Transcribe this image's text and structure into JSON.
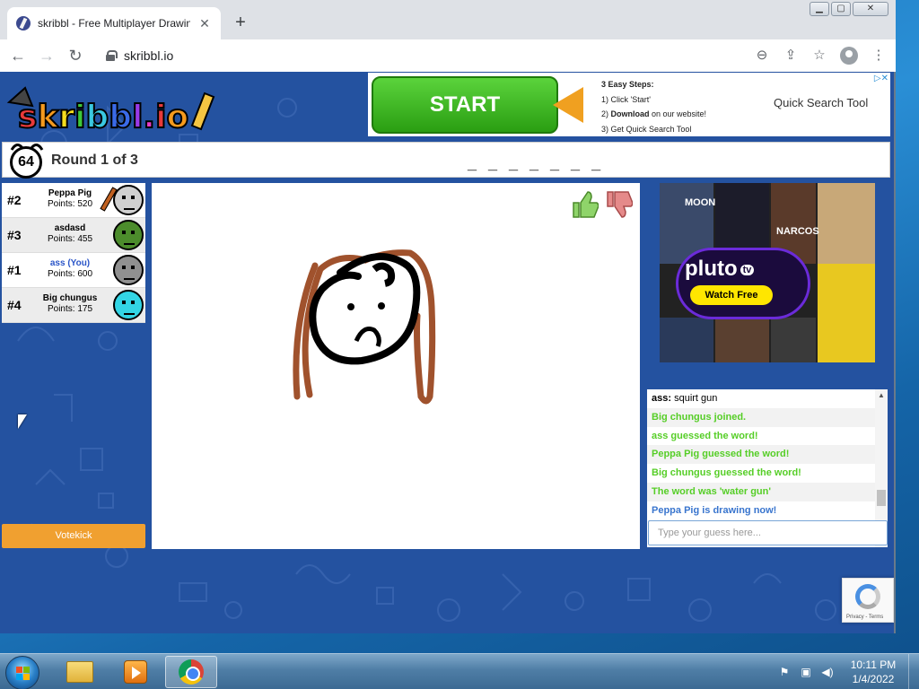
{
  "browser": {
    "tab_title": "skribbl - Free Multiplayer Drawin",
    "url": "skribbl.io"
  },
  "ad_top": {
    "start_label": "START",
    "steps_title": "3 Easy Steps:",
    "step1": "1) Click 'Start'",
    "step2_bold": "Download",
    "step2_prefix": "2) ",
    "step2_rest": " on our website!",
    "step3": "3) Get Quick Search Tool",
    "quick_search": "Quick Search Tool"
  },
  "game": {
    "timer": "64",
    "round_label": "Round 1 of 3",
    "word_hint": "_ _ _ _ _ _ _",
    "votekick_label": "Votekick"
  },
  "players": [
    {
      "rank": "#2",
      "name": "Peppa Pig",
      "points": "Points: 520",
      "you": false,
      "drawing": true,
      "color": "#d0d0d0"
    },
    {
      "rank": "#3",
      "name": "asdasd",
      "points": "Points: 455",
      "you": false,
      "drawing": false,
      "color": "#4c8c2c"
    },
    {
      "rank": "#1",
      "name": "ass (You)",
      "points": "Points: 600",
      "you": true,
      "drawing": false,
      "color": "#909090"
    },
    {
      "rank": "#4",
      "name": "Big chungus",
      "points": "Points: 175",
      "you": false,
      "drawing": false,
      "color": "#33d5e5"
    }
  ],
  "side_ad": {
    "moon": "MOON",
    "narcos": "NARCOS",
    "logo": "pluto",
    "logo_badge": "tv",
    "watch_free": "Watch Free"
  },
  "chat": {
    "messages": [
      {
        "author": "ass:",
        "text": " squirt gun",
        "style": "normal"
      },
      {
        "author": "",
        "text": "Big chungus joined.",
        "style": "green"
      },
      {
        "author": "",
        "text": "ass guessed the word!",
        "style": "green"
      },
      {
        "author": "",
        "text": "Peppa Pig guessed the word!",
        "style": "green"
      },
      {
        "author": "",
        "text": "Big chungus guessed the word!",
        "style": "green"
      },
      {
        "author": "",
        "text": "The word was 'water gun'",
        "style": "green"
      },
      {
        "author": "",
        "text": "Peppa Pig is drawing now!",
        "style": "blue"
      }
    ],
    "guess_placeholder": "Type your guess here..."
  },
  "recaptcha": {
    "text": "Privacy - Terms"
  },
  "taskbar": {
    "time": "10:11 PM",
    "date": "1/4/2022"
  },
  "colors": {
    "page_bg": "#2452a0",
    "votekick": "#f0a030",
    "chat_green": "#56ce27",
    "chat_blue": "#3975ce",
    "hair": "#a0522d"
  }
}
